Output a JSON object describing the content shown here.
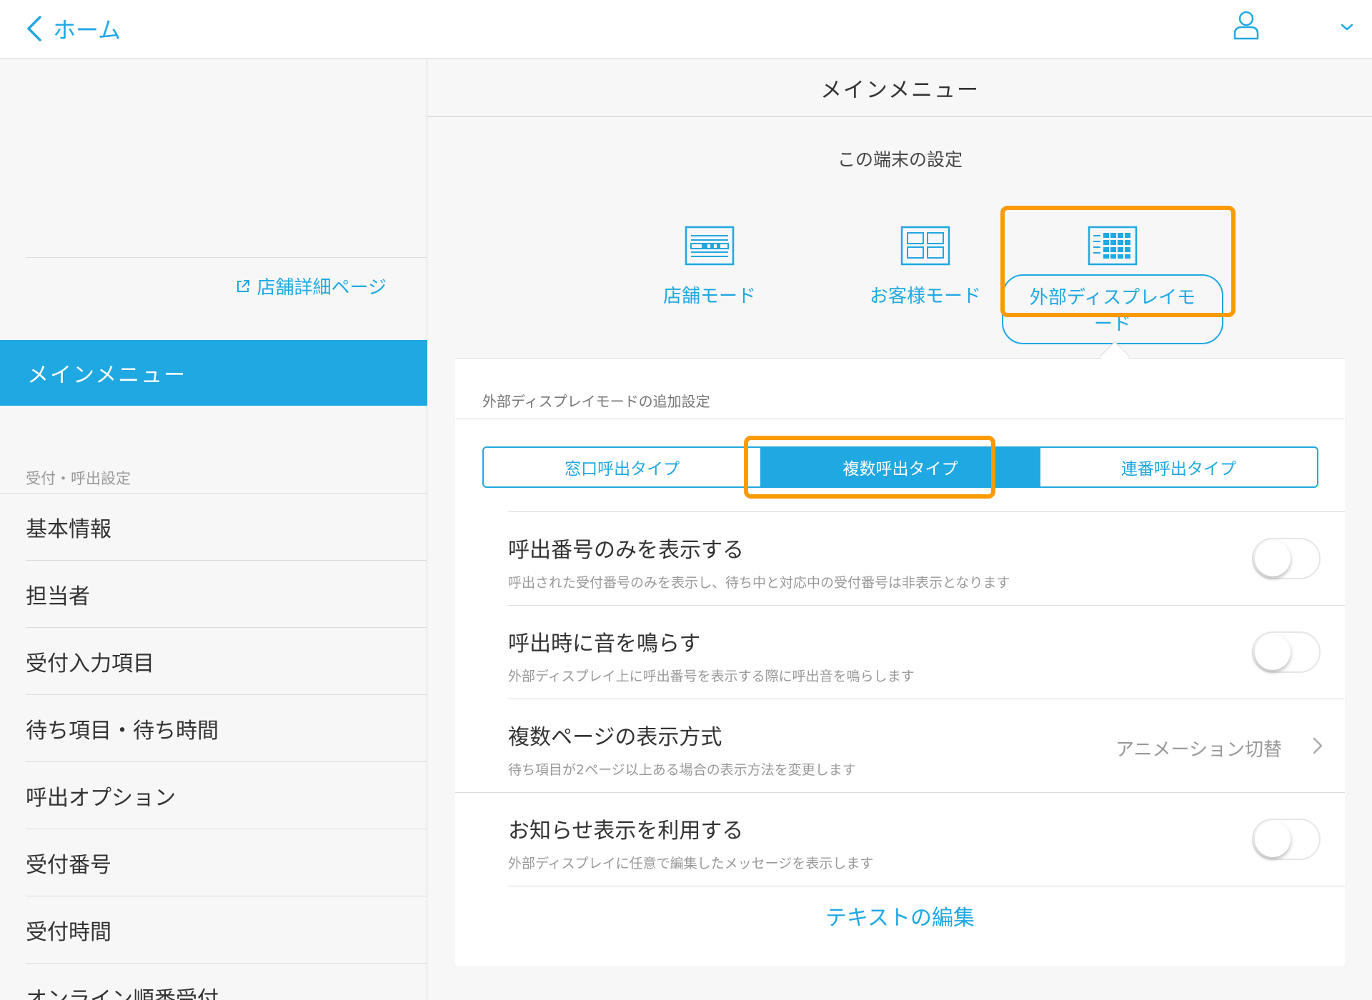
{
  "topbar": {
    "back_label": "ホーム"
  },
  "sidebar": {
    "store_link": "店舗詳細ページ",
    "active_item": "メインメニュー",
    "section_title": "受付・呼出設定",
    "items": [
      "基本情報",
      "担当者",
      "受付入力項目",
      "待ち項目・待ち時間",
      "呼出オプション",
      "受付番号",
      "受付時間",
      "オンライン順番受付"
    ]
  },
  "main": {
    "header": "メインメニュー",
    "device_settings_title": "この端末の設定",
    "modes": [
      "店舗モード",
      "お客様モード",
      "外部ディスプレイモード"
    ],
    "selected_mode": "外部ディスプレイモード",
    "additional_settings_title": "外部ディスプレイモードの追加設定",
    "call_types": [
      "窓口呼出タイプ",
      "複数呼出タイプ",
      "連番呼出タイプ"
    ],
    "selected_call_type": "複数呼出タイプ",
    "settings": [
      {
        "title": "呼出番号のみを表示する",
        "desc": "呼出された受付番号のみを表示し、待ち中と対応中の受付番号は非表示となります",
        "enabled": false
      },
      {
        "title": "呼出時に音を鳴らす",
        "desc": "外部ディスプレイ上に呼出番号を表示する際に呼出音を鳴らします",
        "enabled": false
      },
      {
        "title": "複数ページの表示方式",
        "desc": "待ち項目が2ページ以上ある場合の表示方法を変更します",
        "value": "アニメーション切替"
      },
      {
        "title": "お知らせ表示を利用する",
        "desc": "外部ディスプレイに任意で編集したメッセージを表示します",
        "enabled": false
      }
    ],
    "text_edit_link": "テキストの編集"
  },
  "colors": {
    "accent": "#1fa8e2",
    "highlight": "#ff9a00"
  },
  "icons": [
    "chevron-left-icon",
    "user-icon",
    "chevron-down-icon",
    "external-link-icon",
    "store-mode-icon",
    "customer-mode-icon",
    "external-display-mode-icon",
    "chevron-right-icon"
  ]
}
